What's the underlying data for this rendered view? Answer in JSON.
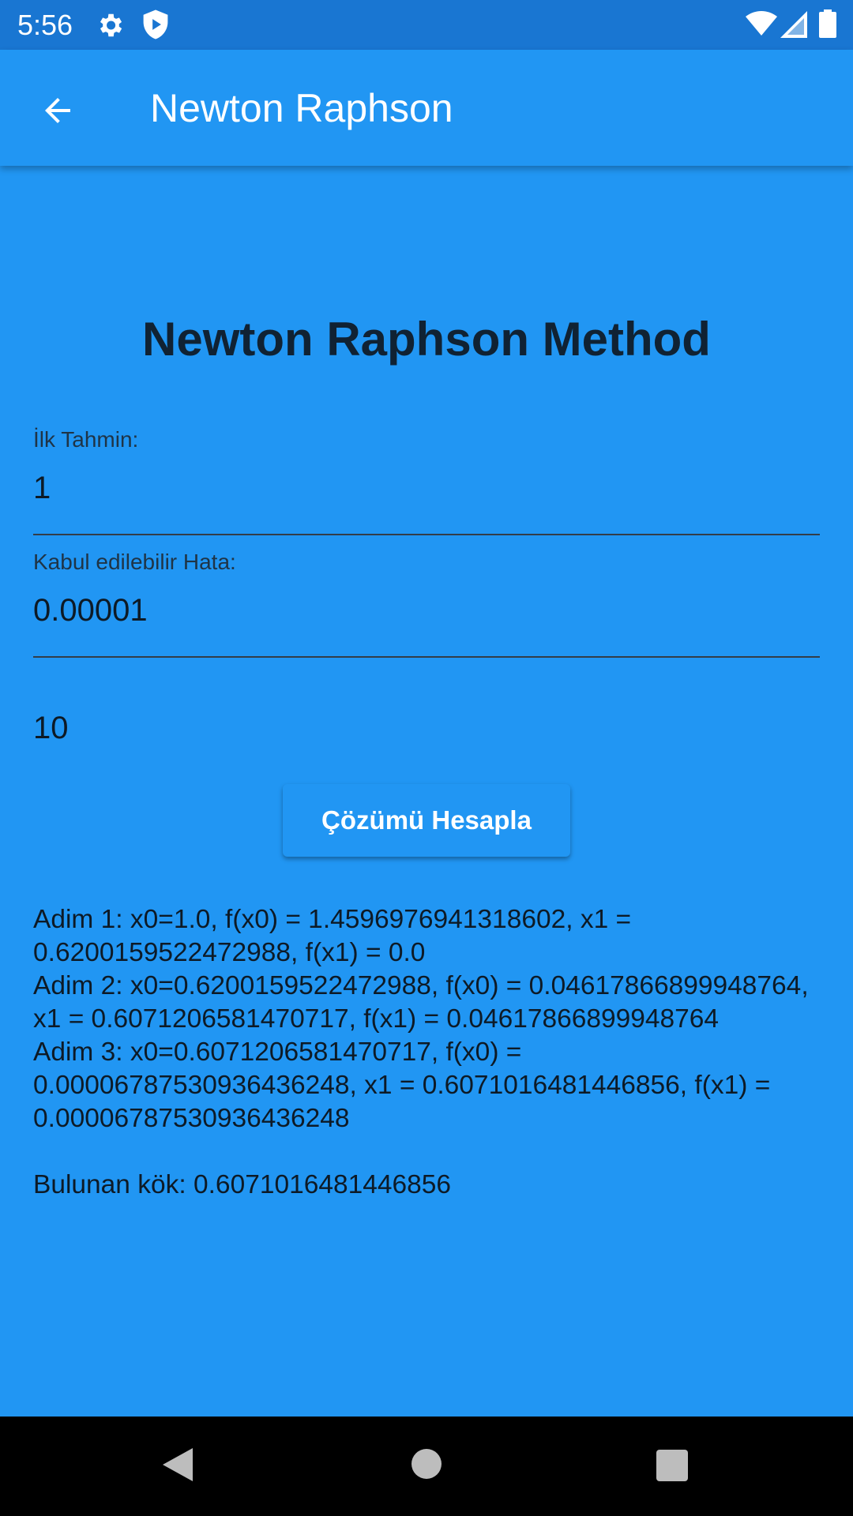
{
  "status_bar": {
    "time": "5:56",
    "icons": [
      "gear-icon",
      "shield-play-icon",
      "wifi-icon",
      "signal-icon",
      "battery-icon"
    ]
  },
  "app_bar": {
    "title": "Newton Raphson",
    "back_icon": "arrow-left-icon"
  },
  "main": {
    "heading": "Newton Raphson Method",
    "initial_guess": {
      "label": "İlk Tahmin:",
      "value": "1"
    },
    "tolerance": {
      "label": "Kabul edilebilir Hata:",
      "value": "0.00001"
    },
    "max_iterations": "10",
    "solve_button_label": "Çözümü Hesapla",
    "steps": [
      "Adim 1: x0=1.0, f(x0) = 1.4596976941318602, x1 = 0.6200159522472988, f(x1) = 0.0",
      "Adim 2: x0=0.6200159522472988, f(x0) = 0.04617866899948764, x1 = 0.6071206581470717, f(x1) = 0.04617866899948764",
      "Adim 3: x0=0.6071206581470717, f(x0) = 0.00006787530936436248, x1 = 0.6071016481446856, f(x1) = 0.00006787530936436248"
    ],
    "root_result": "Bulunan kök: 0.6071016481446856"
  },
  "nav_bar": {
    "buttons": [
      "back-triangle-icon",
      "home-circle-icon",
      "recents-square-icon"
    ]
  },
  "colors": {
    "background": "#2196F3",
    "status_bar": "#1976D2",
    "text_dark": "#0d1a26",
    "nav_bar": "#000000"
  }
}
